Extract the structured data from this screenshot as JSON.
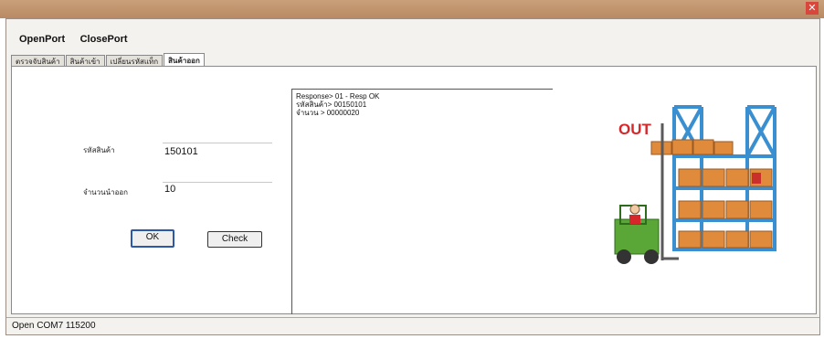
{
  "menu": {
    "open_port": "OpenPort",
    "close_port": "ClosePort"
  },
  "tabs": [
    {
      "label": "ตรวจจับสินค้า",
      "active": false
    },
    {
      "label": "สินค้าเข้า",
      "active": false
    },
    {
      "label": "เปลี่ยนรหัสแท็ก",
      "active": false
    },
    {
      "label": "สินค้าออก",
      "active": true
    }
  ],
  "form": {
    "product_code_label": "รหัสสินค้า",
    "product_code_value": "150101",
    "quantity_label": "จำนวนนำออก",
    "quantity_value": "10",
    "ok_label": "OK",
    "check_label": "Check"
  },
  "log": [
    "Response> 01 - Resp OK",
    "รหัสสินค้า> 00150101",
    "จำนวน > 00000020"
  ],
  "illustration": {
    "out_label": "OUT"
  },
  "status": {
    "text": "Open COM7  115200"
  },
  "colors": {
    "out_text": "#d6282b",
    "rack": "#3a8fd0",
    "boxes": "#e08a3c",
    "forklift": "#5aa637"
  }
}
